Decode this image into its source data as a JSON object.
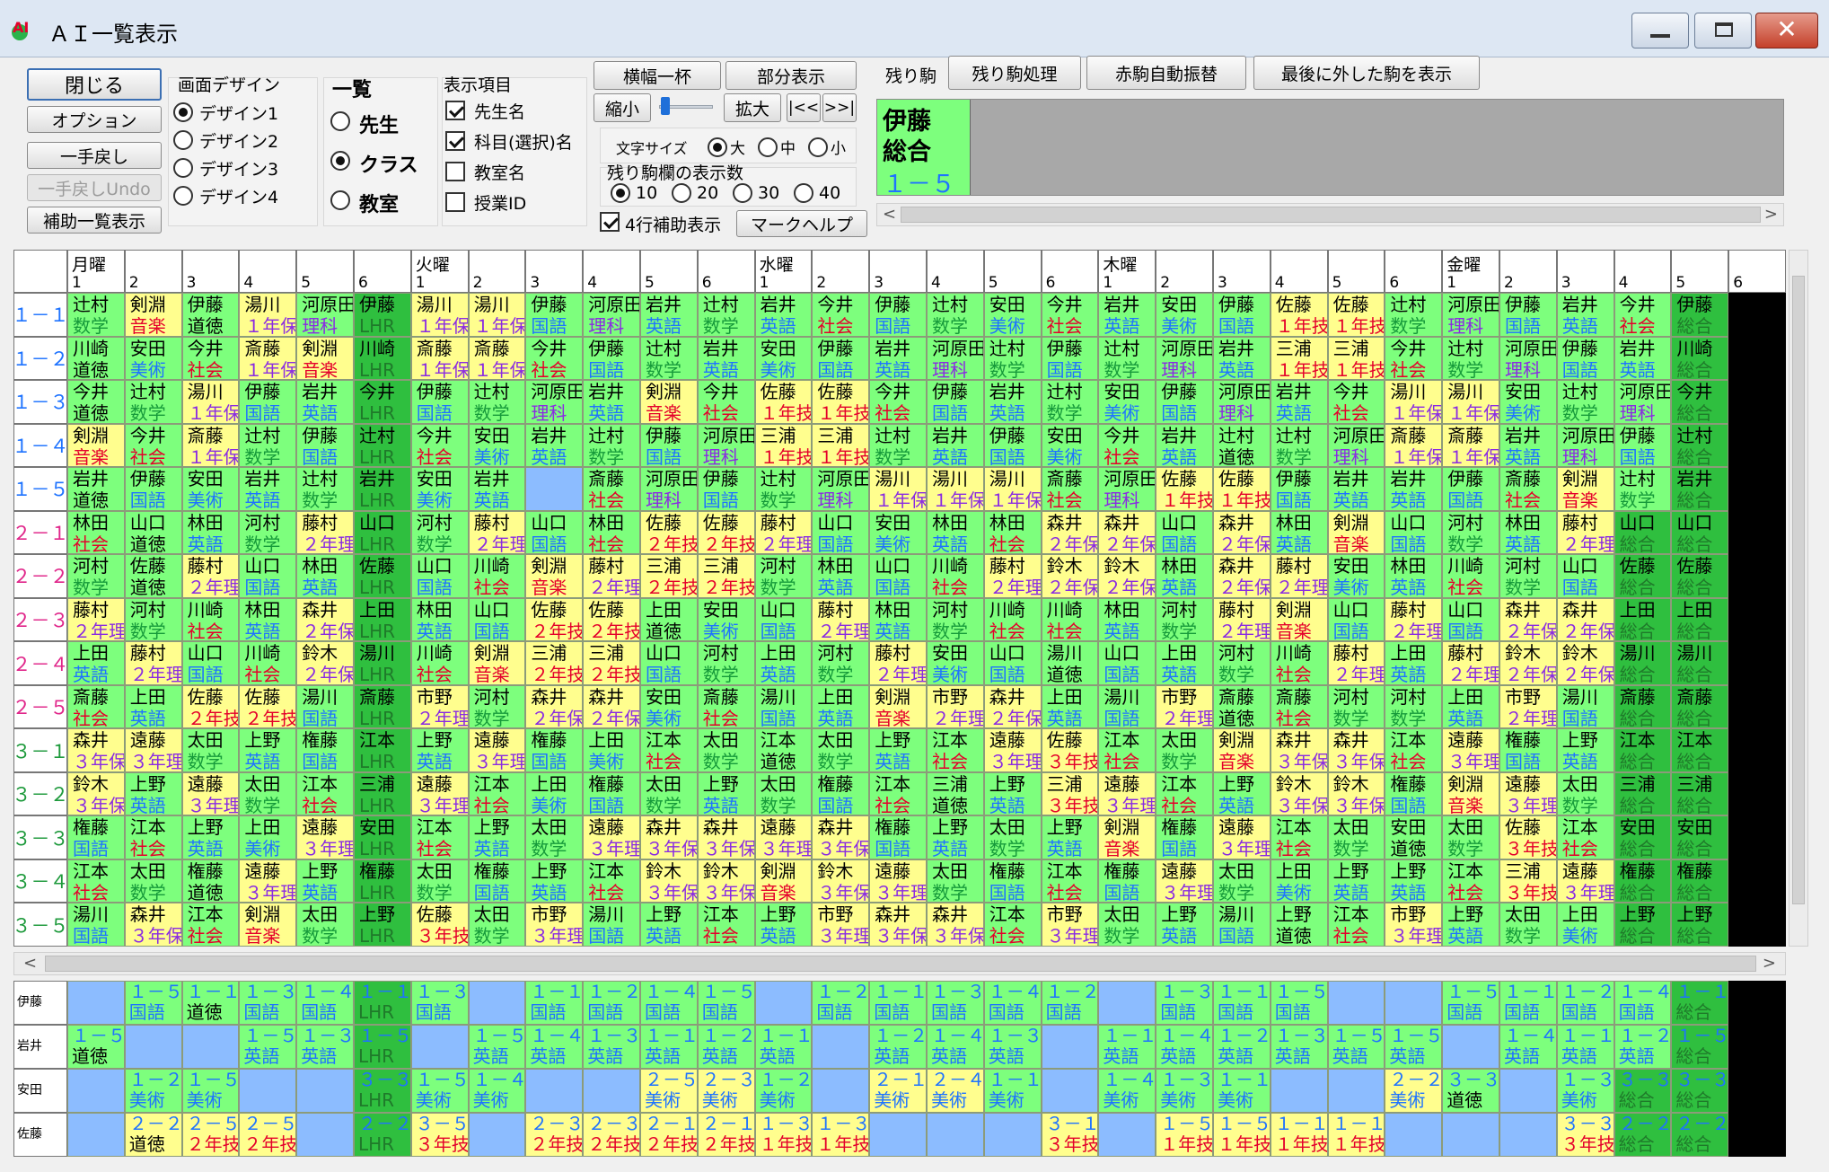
{
  "window": {
    "title": "ＡＩ一覧表示",
    "close_glyph": "✕"
  },
  "colors": {
    "green": "#7dff7d",
    "darkgreen": "#2fbf3f",
    "yellow": "#fffe8e",
    "blue": "#8cbcff",
    "subj_blue": "#1e73ff",
    "subj_red": "#e4002b",
    "subj_green": "#169a3a",
    "subj_purple": "#8a2be2",
    "subj_black": "#000000"
  },
  "toolbar": {
    "close_label": "閉じる",
    "options_label": "オプション",
    "undo_label": "一手戻し",
    "undo_undo_label": "一手戻しUndo",
    "aux_list_label": "補助一覧表示",
    "design_group": {
      "title": "画面デザイン",
      "options": [
        "デザイン1",
        "デザイン2",
        "デザイン3",
        "デザイン4"
      ],
      "selected": 0
    },
    "list_group": {
      "title": "一覧",
      "options": [
        "先生",
        "クラス",
        "教室"
      ],
      "selected": 1
    },
    "display_group": {
      "title": "表示項目",
      "items": [
        {
          "label": "先生名",
          "checked": true
        },
        {
          "label": "科目(選択)名",
          "checked": true
        },
        {
          "label": "教室名",
          "checked": false
        },
        {
          "label": "授業ID",
          "checked": false
        }
      ]
    },
    "full_width_label": "横幅一杯",
    "partial_label": "部分表示",
    "shrink_label": "縮小",
    "enlarge_label": "拡大",
    "first_label": "|<<",
    "last_label": ">>|",
    "font_size": {
      "title": "文字サイズ",
      "options": [
        "大",
        "中",
        "小"
      ],
      "selected": 0
    },
    "remaining_count": {
      "title": "残り駒欄の表示数",
      "options": [
        "10",
        "20",
        "30",
        "40"
      ],
      "selected": 0
    },
    "four_row_aux": {
      "label": "4行補助表示",
      "checked": true
    },
    "mark_help_label": "マークヘルプ",
    "remaining_label": "残り駒",
    "remaining_process_label": "残り駒処理",
    "red_auto_label": "赤駒自動振替",
    "last_removed_label": "最後に外した駒を表示"
  },
  "remaining": [
    {
      "teacher": "伊藤",
      "subject": "総合",
      "klass": "１－５"
    }
  ],
  "scroll_glyphs": {
    "left": "<",
    "right": ">",
    "up": "︿",
    "down": "﹀"
  },
  "timetable": {
    "days": [
      "月曜",
      "火曜",
      "水曜",
      "木曜",
      "金曜"
    ],
    "periods": [
      "1",
      "2",
      "3",
      "4",
      "5",
      "6"
    ],
    "classes": [
      "１－１",
      "１－２",
      "１－３",
      "１－４",
      "１－５",
      "２－１",
      "２－２",
      "２－３",
      "２－４",
      "２－５",
      "３－１",
      "３－２",
      "３－３",
      "３－４",
      "３－５"
    ],
    "rows": [
      [
        "辻村|数学|g",
        "剣淵|音楽|y",
        "伊藤|道徳|g",
        "湯川|１年保|y",
        "河原田|理科|g",
        "伊藤|LHR|d",
        "湯川|１年保|y",
        "湯川|１年保|y",
        "伊藤|国語|g",
        "河原田|理科|g",
        "岩井|英語|g",
        "辻村|数学|g",
        "岩井|英語|g",
        "今井|社会|g",
        "伊藤|国語|g",
        "辻村|数学|g",
        "安田|美術|g",
        "今井|社会|g",
        "岩井|英語|g",
        "安田|美術|g",
        "伊藤|国語|g",
        "佐藤|１年技|y",
        "佐藤|１年技|y",
        "辻村|数学|g",
        "河原田|理科|g",
        "伊藤|国語|g",
        "岩井|英語|g",
        "今井|社会|g",
        "伊藤|総合|d"
      ],
      [
        "川崎|道徳|g",
        "安田|美術|g",
        "今井|社会|g",
        "斎藤|１年保|y",
        "剣淵|音楽|y",
        "川崎|LHR|d",
        "斎藤|１年保|y",
        "斎藤|１年保|y",
        "今井|社会|g",
        "伊藤|国語|g",
        "辻村|数学|g",
        "岩井|英語|g",
        "安田|美術|g",
        "伊藤|国語|g",
        "岩井|英語|g",
        "河原田|理科|g",
        "辻村|数学|g",
        "伊藤|国語|g",
        "辻村|数学|g",
        "河原田|理科|g",
        "岩井|英語|g",
        "三浦|１年技|y",
        "三浦|１年技|y",
        "今井|社会|g",
        "辻村|数学|g",
        "河原田|理科|g",
        "伊藤|国語|g",
        "岩井|英語|g",
        "川崎|総合|d"
      ],
      [
        "今井|道徳|g",
        "辻村|数学|g",
        "湯川|１年保|y",
        "伊藤|国語|g",
        "岩井|英語|g",
        "今井|LHR|d",
        "伊藤|国語|g",
        "辻村|数学|g",
        "河原田|理科|g",
        "岩井|英語|g",
        "剣淵|音楽|y",
        "今井|社会|g",
        "佐藤|１年技|y",
        "佐藤|１年技|y",
        "今井|社会|g",
        "伊藤|国語|g",
        "岩井|英語|g",
        "辻村|数学|g",
        "安田|美術|g",
        "伊藤|国語|g",
        "河原田|理科|g",
        "岩井|英語|g",
        "今井|社会|g",
        "湯川|１年保|y",
        "湯川|１年保|y",
        "安田|美術|g",
        "辻村|数学|g",
        "河原田|理科|g",
        "今井|総合|d"
      ],
      [
        "剣淵|音楽|y",
        "今井|社会|g",
        "斎藤|１年保|y",
        "辻村|数学|g",
        "伊藤|国語|g",
        "辻村|LHR|d",
        "今井|社会|g",
        "安田|美術|g",
        "岩井|英語|g",
        "辻村|数学|g",
        "伊藤|国語|g",
        "河原田|理科|g",
        "三浦|１年技|y",
        "三浦|１年技|y",
        "辻村|数学|g",
        "岩井|英語|g",
        "伊藤|国語|g",
        "安田|美術|g",
        "今井|社会|g",
        "岩井|英語|g",
        "辻村|道徳|g",
        "辻村|数学|g",
        "河原田|理科|g",
        "斎藤|１年保|y",
        "斎藤|１年保|y",
        "岩井|英語|g",
        "河原田|理科|g",
        "伊藤|国語|g",
        "辻村|総合|d"
      ],
      [
        "岩井|道徳|g",
        "伊藤|国語|g",
        "安田|美術|g",
        "岩井|英語|g",
        "辻村|数学|g",
        "岩井|LHR|d",
        "安田|美術|g",
        "岩井|英語|g",
        "||b",
        "斎藤|社会|g",
        "河原田|理科|g",
        "伊藤|国語|g",
        "辻村|数学|g",
        "河原田|理科|g",
        "湯川|１年保|y",
        "湯川|１年保|y",
        "湯川|１年保|y",
        "斎藤|社会|g",
        "河原田|理科|g",
        "佐藤|１年技|y",
        "佐藤|１年技|y",
        "伊藤|国語|g",
        "岩井|英語|g",
        "岩井|英語|g",
        "伊藤|国語|g",
        "斎藤|社会|g",
        "剣淵|音楽|y",
        "辻村|数学|g",
        "岩井|総合|d"
      ],
      [
        "林田|社会|g",
        "山口|道徳|g",
        "林田|英語|g",
        "河村|数学|g",
        "藤村|２年理|y",
        "山口|LHR|d",
        "河村|数学|g",
        "藤村|２年理|y",
        "山口|国語|g",
        "林田|社会|g",
        "佐藤|２年技|y",
        "佐藤|２年技|y",
        "藤村|２年理|y",
        "山口|国語|g",
        "安田|美術|g",
        "林田|英語|g",
        "林田|社会|g",
        "森井|２年保|y",
        "森井|２年保|y",
        "山口|国語|g",
        "森井|２年保|y",
        "林田|英語|g",
        "剣淵|音楽|y",
        "山口|国語|g",
        "河村|数学|g",
        "林田|英語|g",
        "藤村|２年理|y",
        "山口|総合|d",
        "山口|総合|d"
      ],
      [
        "河村|数学|g",
        "佐藤|道徳|g",
        "藤村|２年理|y",
        "山口|国語|g",
        "林田|英語|g",
        "佐藤|LHR|d",
        "山口|国語|g",
        "川崎|社会|g",
        "剣淵|音楽|y",
        "藤村|２年理|y",
        "三浦|２年技|y",
        "三浦|２年技|y",
        "河村|数学|g",
        "林田|英語|g",
        "山口|国語|g",
        "川崎|社会|g",
        "藤村|２年理|y",
        "鈴木|２年保|y",
        "鈴木|２年保|y",
        "林田|英語|g",
        "森井|２年保|y",
        "藤村|２年理|y",
        "安田|美術|g",
        "林田|英語|g",
        "川崎|社会|g",
        "河村|数学|g",
        "山口|国語|g",
        "佐藤|総合|d",
        "佐藤|総合|d"
      ],
      [
        "藤村|２年理|y",
        "河村|数学|g",
        "川崎|社会|g",
        "林田|英語|g",
        "森井|２年保|y",
        "上田|LHR|d",
        "林田|英語|g",
        "山口|国語|g",
        "佐藤|２年技|y",
        "佐藤|２年技|y",
        "上田|道徳|g",
        "安田|美術|g",
        "山口|国語|g",
        "藤村|２年理|y",
        "林田|英語|g",
        "河村|数学|g",
        "川崎|社会|g",
        "川崎|社会|g",
        "林田|英語|g",
        "河村|数学|g",
        "藤村|２年理|y",
        "剣淵|音楽|y",
        "山口|国語|g",
        "藤村|２年理|y",
        "山口|国語|g",
        "森井|２年保|y",
        "森井|２年保|y",
        "上田|総合|d",
        "上田|総合|d"
      ],
      [
        "上田|英語|g",
        "藤村|２年理|y",
        "山口|国語|g",
        "川崎|社会|g",
        "鈴木|２年保|y",
        "湯川|LHR|d",
        "川崎|社会|g",
        "剣淵|音楽|y",
        "三浦|２年技|y",
        "三浦|２年技|y",
        "山口|国語|g",
        "河村|数学|g",
        "上田|英語|g",
        "河村|数学|g",
        "藤村|２年理|y",
        "安田|美術|g",
        "山口|国語|g",
        "湯川|道徳|g",
        "山口|国語|g",
        "上田|英語|g",
        "河村|数学|g",
        "川崎|社会|g",
        "藤村|２年理|y",
        "上田|英語|g",
        "藤村|２年理|y",
        "鈴木|２年保|y",
        "鈴木|２年保|y",
        "湯川|総合|d",
        "湯川|総合|d"
      ],
      [
        "斎藤|社会|g",
        "上田|英語|g",
        "佐藤|２年技|y",
        "佐藤|２年技|y",
        "湯川|国語|g",
        "斎藤|LHR|d",
        "市野|２年理|y",
        "河村|数学|g",
        "森井|２年保|y",
        "森井|２年保|y",
        "安田|美術|g",
        "斎藤|社会|g",
        "湯川|国語|g",
        "上田|英語|g",
        "剣淵|音楽|y",
        "市野|２年理|y",
        "森井|２年保|y",
        "上田|英語|g",
        "湯川|国語|g",
        "市野|２年理|y",
        "斎藤|道徳|g",
        "斎藤|社会|g",
        "河村|数学|g",
        "河村|数学|g",
        "上田|英語|g",
        "市野|２年理|y",
        "湯川|国語|g",
        "斎藤|総合|d",
        "斎藤|総合|d"
      ],
      [
        "森井|３年保|y",
        "遠藤|３年理|y",
        "太田|数学|g",
        "上野|英語|g",
        "権藤|国語|g",
        "江本|LHR|d",
        "上野|英語|g",
        "遠藤|３年理|y",
        "権藤|国語|g",
        "上田|美術|g",
        "江本|社会|g",
        "太田|数学|g",
        "江本|道徳|g",
        "太田|数学|g",
        "上野|英語|g",
        "江本|社会|g",
        "遠藤|３年理|y",
        "佐藤|３年技|y",
        "江本|社会|g",
        "太田|数学|g",
        "剣淵|音楽|y",
        "森井|３年保|y",
        "森井|３年保|y",
        "江本|社会|g",
        "遠藤|３年理|y",
        "権藤|国語|g",
        "上野|英語|g",
        "江本|総合|d",
        "江本|総合|d"
      ],
      [
        "鈴木|３年保|y",
        "上野|英語|g",
        "遠藤|３年理|y",
        "太田|数学|g",
        "江本|社会|g",
        "三浦|LHR|d",
        "遠藤|３年理|y",
        "江本|社会|g",
        "上田|美術|g",
        "権藤|国語|g",
        "太田|数学|g",
        "上野|英語|g",
        "太田|数学|g",
        "権藤|国語|g",
        "江本|社会|g",
        "三浦|道徳|g",
        "上野|英語|g",
        "三浦|３年技|y",
        "遠藤|３年理|y",
        "江本|社会|g",
        "上野|英語|g",
        "鈴木|３年保|y",
        "鈴木|３年保|y",
        "権藤|国語|g",
        "剣淵|音楽|y",
        "遠藤|３年理|y",
        "太田|数学|g",
        "三浦|総合|d",
        "三浦|総合|d"
      ],
      [
        "権藤|国語|g",
        "江本|社会|g",
        "上野|英語|g",
        "上田|美術|g",
        "遠藤|３年理|y",
        "安田|LHR|d",
        "江本|社会|g",
        "上野|英語|g",
        "太田|数学|g",
        "遠藤|３年理|y",
        "森井|３年保|y",
        "森井|３年保|y",
        "遠藤|３年理|y",
        "森井|３年保|y",
        "権藤|国語|g",
        "上野|英語|g",
        "太田|数学|g",
        "上野|英語|g",
        "剣淵|音楽|y",
        "権藤|国語|g",
        "遠藤|３年理|y",
        "江本|社会|g",
        "太田|数学|g",
        "安田|道徳|g",
        "太田|数学|g",
        "佐藤|３年技|y",
        "江本|社会|g",
        "安田|総合|d",
        "安田|総合|d"
      ],
      [
        "江本|社会|g",
        "太田|数学|g",
        "権藤|道徳|g",
        "遠藤|３年理|y",
        "上野|英語|g",
        "権藤|LHR|d",
        "太田|数学|g",
        "権藤|国語|g",
        "上野|英語|g",
        "江本|社会|g",
        "鈴木|３年保|y",
        "鈴木|３年保|y",
        "剣淵|音楽|y",
        "鈴木|３年保|y",
        "遠藤|３年理|y",
        "太田|数学|g",
        "権藤|国語|g",
        "江本|社会|g",
        "権藤|国語|g",
        "遠藤|３年理|y",
        "太田|数学|g",
        "上田|美術|g",
        "上野|英語|g",
        "上野|英語|g",
        "江本|社会|g",
        "三浦|３年技|y",
        "遠藤|３年理|y",
        "権藤|総合|d",
        "権藤|総合|d"
      ],
      [
        "湯川|国語|g",
        "森井|３年保|y",
        "江本|社会|g",
        "剣淵|音楽|y",
        "太田|数学|g",
        "上野|LHR|d",
        "佐藤|３年技|y",
        "太田|数学|g",
        "市野|３年理|y",
        "湯川|国語|g",
        "上野|英語|g",
        "江本|社会|g",
        "上野|英語|g",
        "市野|３年理|y",
        "森井|３年保|y",
        "森井|３年保|y",
        "江本|社会|g",
        "市野|３年理|y",
        "太田|数学|g",
        "上野|英語|g",
        "湯川|国語|g",
        "上野|道徳|g",
        "江本|社会|g",
        "市野|３年理|y",
        "上野|英語|g",
        "太田|数学|g",
        "上田|美術|g",
        "上野|総合|d",
        "上野|総合|d"
      ]
    ]
  },
  "teacher_table": {
    "teachers": [
      "伊藤",
      "岩井",
      "安田",
      "佐藤"
    ],
    "rows": [
      [
        "||b",
        "１－５|国語|g",
        "１－１|道徳|g",
        "１－３|国語|g",
        "１－４|国語|g",
        "１－１|LHR|d",
        "１－３|国語|g",
        "||b",
        "１－１|国語|g",
        "１－２|国語|g",
        "１－４|国語|g",
        "１－５|国語|g",
        "||b",
        "１－２|国語|g",
        "１－１|国語|g",
        "１－３|国語|g",
        "１－４|国語|g",
        "１－２|国語|g",
        "||b",
        "１－３|国語|g",
        "１－１|国語|g",
        "１－５|国語|g",
        "||b",
        "||b",
        "１－５|国語|g",
        "１－１|国語|g",
        "１－２|国語|g",
        "１－４|国語|g",
        "１－１|総合|d"
      ],
      [
        "１－５|道徳|g",
        "||b",
        "||b",
        "１－５|英語|g",
        "１－３|英語|g",
        "１－５|LHR|d",
        "||b",
        "１－５|英語|g",
        "１－４|英語|g",
        "１－３|英語|g",
        "１－１|英語|g",
        "１－２|英語|g",
        "１－１|英語|g",
        "||b",
        "１－２|英語|g",
        "１－４|英語|g",
        "１－３|英語|g",
        "||b",
        "１－１|英語|g",
        "１－４|英語|g",
        "１－２|英語|g",
        "１－３|英語|g",
        "１－５|英語|g",
        "１－５|英語|g",
        "||b",
        "１－４|英語|g",
        "１－１|英語|g",
        "１－２|英語|g",
        "１－５|総合|d"
      ],
      [
        "||b",
        "１－２|美術|g",
        "１－５|美術|g",
        "||b",
        "||b",
        "３－３|LHR|d",
        "１－５|美術|g",
        "１－４|美術|g",
        "||b",
        "||b",
        "２－５|美術|y",
        "２－３|美術|y",
        "１－２|美術|g",
        "||b",
        "２－１|美術|y",
        "２－４|美術|y",
        "１－１|美術|g",
        "||b",
        "１－４|美術|g",
        "１－３|美術|g",
        "１－１|美術|g",
        "||b",
        "||b",
        "２－２|美術|y",
        "３－３|道徳|g",
        "||b",
        "１－３|美術|g",
        "３－３|総合|d",
        "３－３|総合|d"
      ],
      [
        "||b",
        "２－２|道徳|y",
        "２－５|２年技|y",
        "２－５|２年技|y",
        "||b",
        "２－２|LHR|d",
        "３－５|３年技|y",
        "||b",
        "２－３|２年技|y",
        "２－３|２年技|y",
        "２－１|２年技|y",
        "２－１|２年技|y",
        "１－３|１年技|y",
        "１－３|１年技|y",
        "||b",
        "||b",
        "||b",
        "３－１|３年技|y",
        "||b",
        "１－５|１年技|y",
        "１－５|１年技|y",
        "１－１|１年技|y",
        "１－１|１年技|y",
        "||b",
        "||b",
        "||b",
        "３－３|３年技|y",
        "２－２|総合|d",
        "２－２|総合|d"
      ]
    ]
  }
}
